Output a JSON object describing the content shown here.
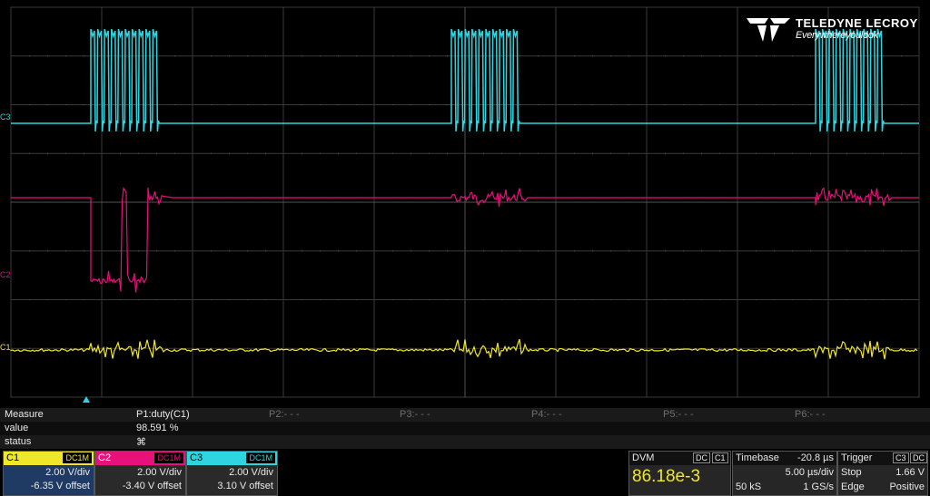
{
  "branding": {
    "name": "TELEDYNE LECROY",
    "tagline": "Everywhereyoulook"
  },
  "colors": {
    "c1": "#f0e62a",
    "c2": "#e8107a",
    "c3": "#2ed5e0",
    "grid": "#3a3a3a",
    "dots": "#5a5a5a"
  },
  "channels_markers": {
    "c3": "C3",
    "c2": "C2",
    "c1": "C1"
  },
  "measure": {
    "header": "Measure",
    "row_value": "value",
    "row_status": "status",
    "p1": {
      "label": "P1:duty(C1)",
      "value": "98.591 %",
      "status": "⌘"
    },
    "p2": "P2:- - -",
    "p3": "P3:- - -",
    "p4": "P4:- - -",
    "p5": "P5:- - -",
    "p6": "P6:- - -"
  },
  "channel_boxes": [
    {
      "name": "C1",
      "coupling": "DC1M",
      "vdiv": "2.00 V/div",
      "offset": "-6.35 V offset"
    },
    {
      "name": "C2",
      "coupling": "DC1M",
      "vdiv": "2.00 V/div",
      "offset": "-3.40 V offset"
    },
    {
      "name": "C3",
      "coupling": "DC1M",
      "vdiv": "2.00 V/div",
      "offset": "3.10 V offset"
    }
  ],
  "dvm": {
    "label": "DVM",
    "coupling": "DC",
    "channel": "C1",
    "value": "86.18e-3"
  },
  "timebase": {
    "label": "Timebase",
    "delay": "-20.8 µs",
    "tdiv": "5.00 µs/div",
    "samples": "50 kS",
    "rate": "1 GS/s"
  },
  "trigger": {
    "label": "Trigger",
    "channel": "C3",
    "coupling": "DC",
    "mode": "Stop",
    "level": "1.66 V",
    "type": "Edge",
    "slope": "Positive"
  },
  "waveform": {
    "bursts_start_div": [
      0.88,
      4.85,
      8.86
    ],
    "burst_pulses": 10,
    "pulse_spacing_div": 0.076
  }
}
